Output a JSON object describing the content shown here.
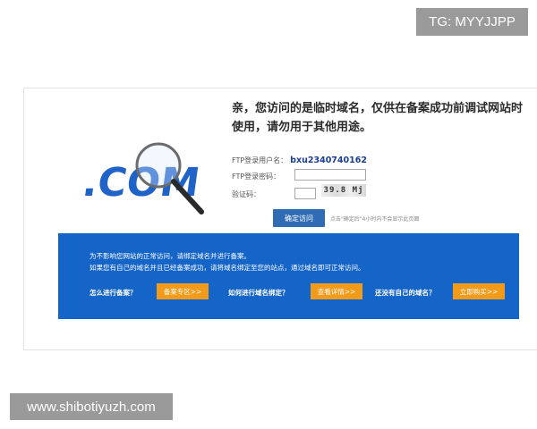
{
  "watermarks": {
    "top": "TG: MYYJJPP",
    "bottom": "www.shibotiyuzh.com"
  },
  "logo": {
    "text": ".COM"
  },
  "headline": "亲，您访问的是临时域名，仅供在备案成功前调试网站时使用，请勿用于其他用途。",
  "form": {
    "ftp_user_label": "FTP登录用户名：",
    "ftp_user_value": "bxu2340740162",
    "ftp_pwd_label": "FTP登录密码：",
    "captcha_label": "验证码：",
    "captcha_text": "39.8 Mj"
  },
  "confirm_button": "确定访问",
  "hint": "点击\"确定后\"4小时内不会显示此页面",
  "notice": {
    "line1": "为不影响您网站的正常访问，请绑定域名并进行备案。",
    "line2": "如果您有自己的域名并且已经备案成功，请将域名绑定至您的站点，通过域名即可正常访问。"
  },
  "actions": [
    {
      "question": "怎么进行备案？",
      "button": "备案专区>>"
    },
    {
      "question": "如何进行域名绑定？",
      "button": "查看详情>>"
    },
    {
      "question": "还没有自己的域名？",
      "button": "立即购买>>"
    }
  ],
  "colors": {
    "brand_blue": "#1565c8",
    "button_blue": "#2f6cb5",
    "accent_orange": "#f29a1a"
  }
}
